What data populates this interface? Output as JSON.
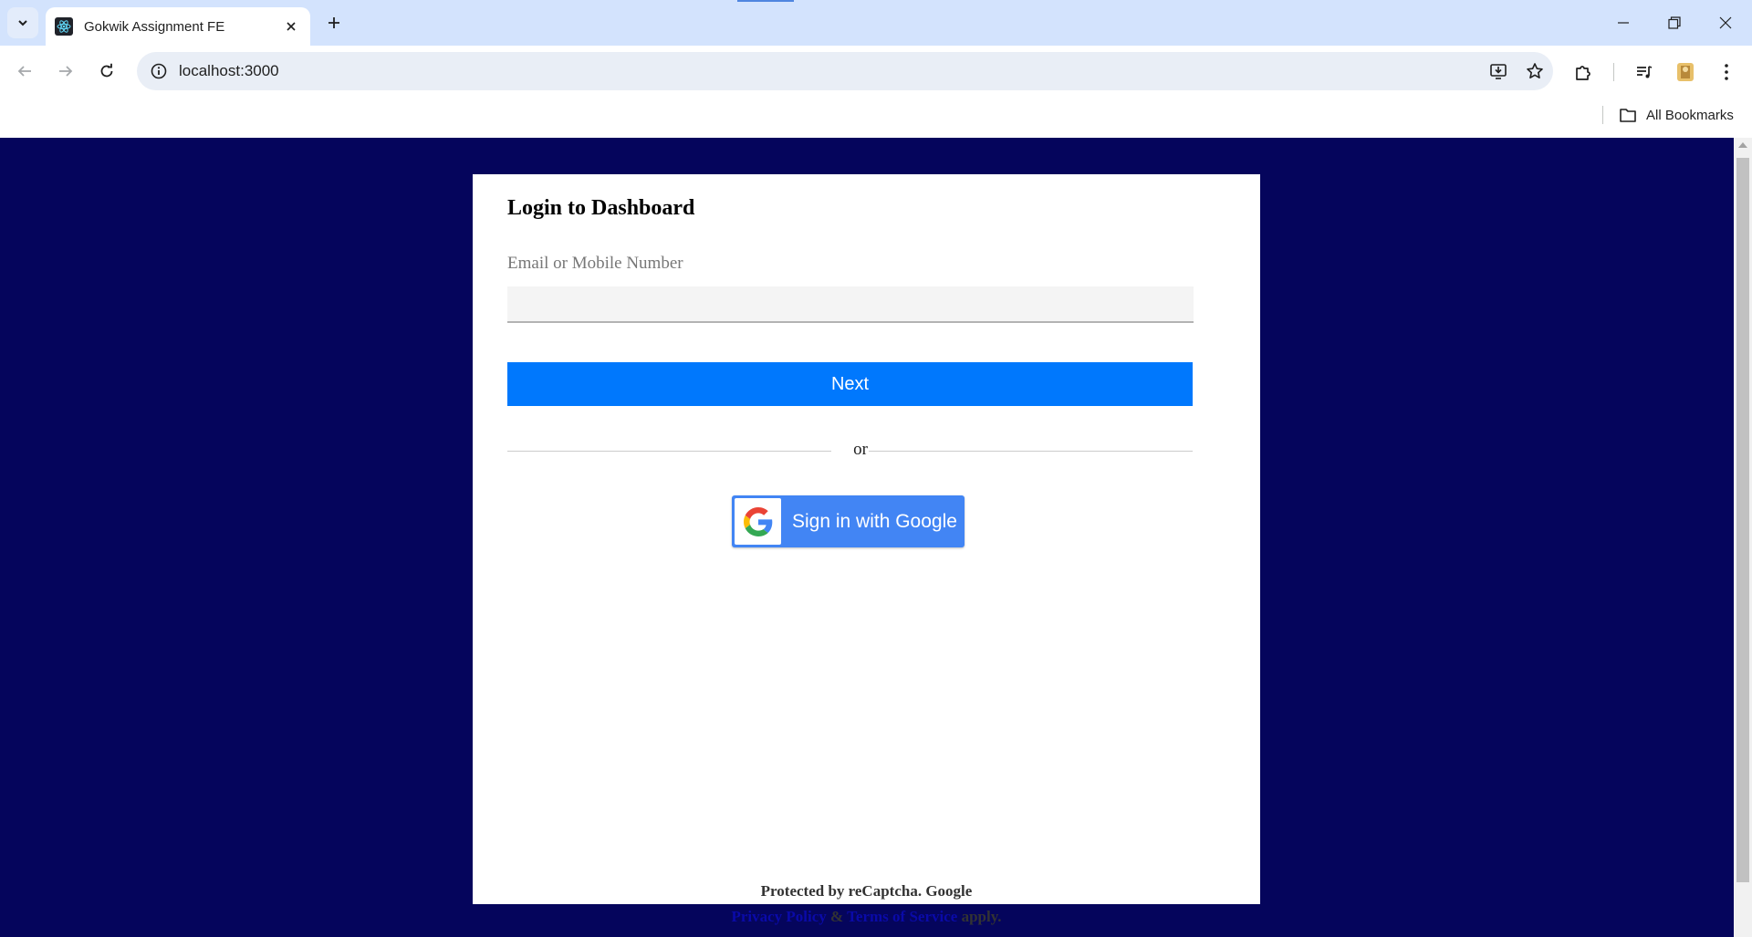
{
  "browser": {
    "tab_title": "Gokwik Assignment FE",
    "url": "localhost:3000",
    "bookmarks_label": "All Bookmarks"
  },
  "login": {
    "title": "Login to Dashboard",
    "field_label": "Email or Mobile Number",
    "field_value": "",
    "next_label": "Next",
    "divider_text": "or",
    "google_label": "Sign in with Google",
    "footer_line1": "Protected by reCaptcha. Google",
    "privacy_link": "Privacy Policy",
    "ampersand": "&",
    "terms_link": "Terms of Service",
    "apply_text": "apply."
  },
  "colors": {
    "page_background": "#05055c",
    "next_button": "#0078fd",
    "google_button": "#4285f4",
    "link": "#0a0aa8"
  }
}
